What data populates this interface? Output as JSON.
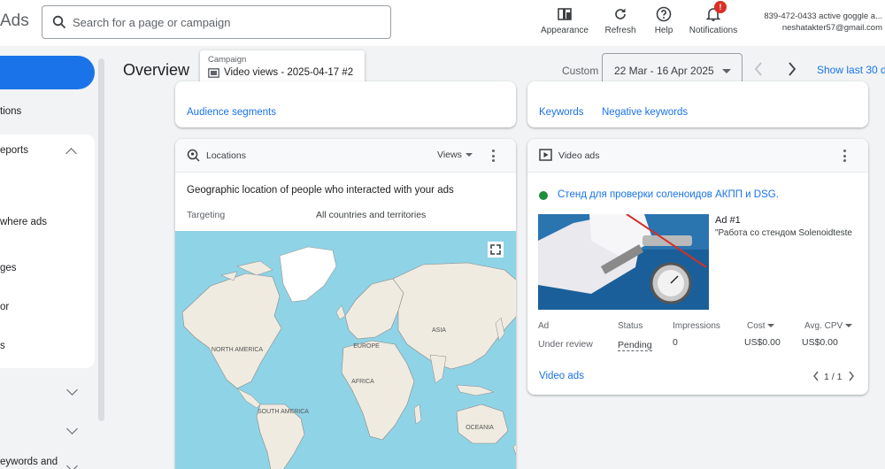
{
  "brand": "Ads",
  "search": {
    "placeholder": "Search for a page or campaign"
  },
  "toolbar": {
    "appearance": "Appearance",
    "refresh": "Refresh",
    "help": "Help",
    "notifications": "Notifications",
    "notifications_badge": "!"
  },
  "account": {
    "name": "839-472-0433 active goggle a...",
    "email": "neshatakter57@gmail.com"
  },
  "header": {
    "title": "Overview",
    "campaign_label": "Campaign",
    "campaign_value": "Video views - 2025-04-17 #2",
    "custom_label": "Custom",
    "date_range": "22 Mar - 16 Apr 2025",
    "show_last": "Show last 30 d"
  },
  "sidebar": {
    "items": [
      {
        "label": "tions"
      },
      {
        "label": "eports"
      },
      {
        "label": "where ads"
      },
      {
        "label": "ges"
      },
      {
        "label": "or"
      },
      {
        "label": "s"
      },
      {
        "label": "eywords and"
      }
    ]
  },
  "cards": {
    "audience": {
      "link": "Audience segments"
    },
    "keywords": {
      "link1": "Keywords",
      "link2": "Negative keywords"
    },
    "locations": {
      "title": "Locations",
      "dropdown": "Views",
      "heading": "Geographic location of people who interacted with your ads",
      "targeting_label": "Targeting",
      "targeting_value": "All countries and territories",
      "map_labels": [
        "NORTH AMERICA",
        "EUROPE",
        "ASIA",
        "AFRICA",
        "SOUTH AMERICA",
        "OCEANIA"
      ]
    },
    "video_ads": {
      "title": "Video ads",
      "ad_title": "Стенд для проверки соленоидов АКПП и DSG.",
      "ad_number": "Ad #1",
      "ad_desc": "\"Работа со стендом Solenoidteste",
      "columns": [
        "Ad",
        "Status",
        "Impressions",
        "Cost",
        "Avg. CPV"
      ],
      "row": [
        "Under review",
        "Pending",
        "0",
        "US$0.00",
        "US$0.00"
      ],
      "footer_link": "Video ads",
      "pagination": "1 / 1",
      "status_color": "#1e8e3e"
    }
  },
  "colors": {
    "accent": "#1a73e8",
    "ocean": "#8fd3e6",
    "land": "#efebe0"
  }
}
